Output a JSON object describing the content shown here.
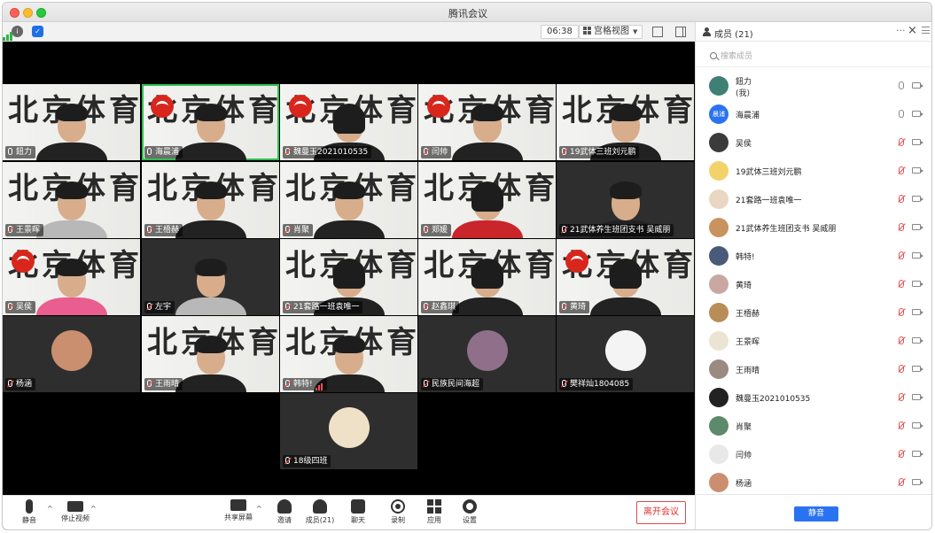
{
  "window": {
    "title": "腾讯会议"
  },
  "topbar": {
    "timer": "06:38",
    "view_label": "宫格视图"
  },
  "tiles": [
    {
      "name": "鈕力",
      "mic": "on",
      "bg": "bright",
      "logo": false,
      "avatar": ""
    },
    {
      "name": "海晨浦",
      "mic": "on",
      "bg": "bright",
      "logo": true,
      "avatar": ""
    },
    {
      "name": "魏曼玉2021010535",
      "mic": "muted",
      "bg": "bright",
      "logo": true,
      "avatar": ""
    },
    {
      "name": "闫帅",
      "mic": "muted",
      "bg": "bright",
      "logo": true,
      "avatar": ""
    },
    {
      "name": "19武体三班刘元鹏",
      "mic": "muted",
      "bg": "bright",
      "logo": false,
      "avatar": ""
    },
    {
      "name": "王景晖",
      "mic": "muted",
      "bg": "bright",
      "logo": false,
      "avatar": ""
    },
    {
      "name": "王梧赫",
      "mic": "muted",
      "bg": "bright",
      "logo": false,
      "avatar": ""
    },
    {
      "name": "肖聚",
      "mic": "muted",
      "bg": "bright",
      "logo": false,
      "avatar": ""
    },
    {
      "name": "郑媛",
      "mic": "muted",
      "bg": "bright",
      "logo": false,
      "avatar": ""
    },
    {
      "name": "21武体养生班团支书 吴威朋",
      "mic": "muted",
      "bg": "gray",
      "logo": false,
      "avatar": ""
    },
    {
      "name": "吴侯",
      "mic": "muted",
      "bg": "bright",
      "logo": true,
      "avatar": ""
    },
    {
      "name": "左宇",
      "mic": "muted",
      "bg": "gray",
      "logo": false,
      "avatar": ""
    },
    {
      "name": "21套路一班袁唯一",
      "mic": "muted",
      "bg": "bright",
      "logo": false,
      "avatar": ""
    },
    {
      "name": "赵鑫琪",
      "mic": "muted",
      "bg": "bright",
      "logo": false,
      "avatar": ""
    },
    {
      "name": "黄琦",
      "mic": "muted",
      "bg": "bright",
      "logo": true,
      "avatar": ""
    },
    {
      "name": "杨涵",
      "mic": "muted",
      "bg": "gray",
      "logo": false,
      "avatar": "#c98f6f"
    },
    {
      "name": "王雨晴",
      "mic": "muted",
      "bg": "bright",
      "logo": false,
      "avatar": ""
    },
    {
      "name": "韩特!",
      "mic": "muted",
      "bg": "bright",
      "logo": false,
      "avatar": ""
    },
    {
      "name": "民族民间海超",
      "mic": "muted",
      "bg": "gray",
      "logo": false,
      "avatar": "#8f6f8a"
    },
    {
      "name": "樊祥灿1804085",
      "mic": "muted",
      "bg": "gray",
      "logo": false,
      "avatar": "#f4f4f4"
    },
    {
      "name": "18级四班",
      "mic": "muted",
      "bg": "gray",
      "logo": false,
      "avatar": "#efe1c8"
    }
  ],
  "toolbar": {
    "mute": "静音",
    "stop_video": "停止视频",
    "share": "共享屏幕",
    "invite": "邀请",
    "members": "成员(21)",
    "chat": "聊天",
    "record": "录制",
    "apps": "应用",
    "settings": "设置",
    "leave": "离开会议"
  },
  "panel": {
    "title": "成员 (21)",
    "search_placeholder": "搜索成员",
    "mute_all": "静音",
    "members": [
      {
        "name": "鈕力",
        "sub": "(我)",
        "mic": "on",
        "cam": "on",
        "avatar": "#3f7f76"
      },
      {
        "name": "海晨浦",
        "sub": "",
        "mic": "on",
        "cam": "on",
        "avatar": "#2a73f0",
        "initials": "晨浦"
      },
      {
        "name": "吴侯",
        "sub": "",
        "mic": "muted",
        "cam": "on",
        "avatar": "#3b3b3b"
      },
      {
        "name": "19武体三班刘元鹏",
        "sub": "",
        "mic": "muted",
        "cam": "on",
        "avatar": "#f2d36b"
      },
      {
        "name": "21套路一班袁唯一",
        "sub": "",
        "mic": "muted",
        "cam": "on",
        "avatar": "#e9d7c3"
      },
      {
        "name": "21武体养生班团支书 吴威朋",
        "sub": "",
        "mic": "muted",
        "cam": "on",
        "avatar": "#c8935e"
      },
      {
        "name": "韩特!",
        "sub": "",
        "mic": "muted",
        "cam": "on",
        "avatar": "#4a5a7a"
      },
      {
        "name": "黄琦",
        "sub": "",
        "mic": "muted",
        "cam": "on",
        "avatar": "#c9a8a2"
      },
      {
        "name": "王梧赫",
        "sub": "",
        "mic": "muted",
        "cam": "on",
        "avatar": "#b88d57"
      },
      {
        "name": "王景晖",
        "sub": "",
        "mic": "muted",
        "cam": "on",
        "avatar": "#ece4d2"
      },
      {
        "name": "王雨晴",
        "sub": "",
        "mic": "muted",
        "cam": "on",
        "avatar": "#9b8a7f"
      },
      {
        "name": "魏曼玉2021010535",
        "sub": "",
        "mic": "muted",
        "cam": "on",
        "avatar": "#222222"
      },
      {
        "name": "肖聚",
        "sub": "",
        "mic": "muted",
        "cam": "on",
        "avatar": "#5d8a6a"
      },
      {
        "name": "闫帅",
        "sub": "",
        "mic": "muted",
        "cam": "on",
        "avatar": "#e8e8e8"
      },
      {
        "name": "杨涵",
        "sub": "",
        "mic": "muted",
        "cam": "on",
        "avatar": "#c98f6f"
      }
    ]
  }
}
